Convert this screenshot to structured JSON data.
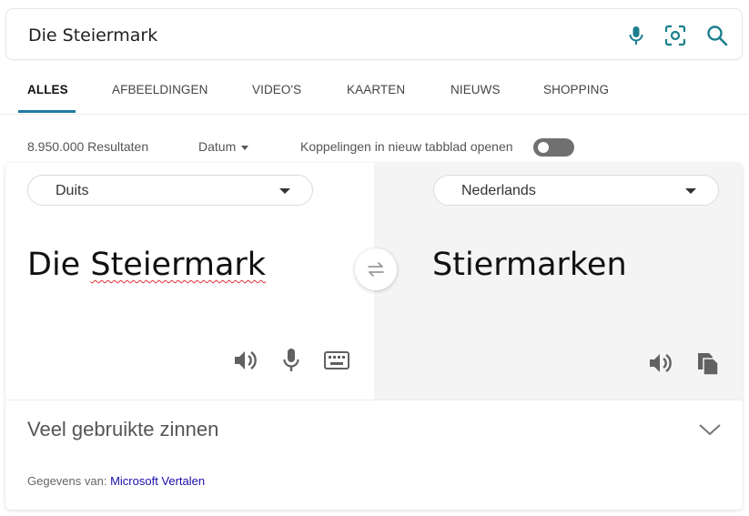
{
  "search": {
    "query": "Die Steiermark"
  },
  "icons": {
    "mic": "microphone-icon",
    "visual": "visual-search-icon",
    "search": "search-icon"
  },
  "tabs": [
    {
      "label": "ALLES",
      "active": true
    },
    {
      "label": "AFBEELDINGEN"
    },
    {
      "label": "VIDEO'S"
    },
    {
      "label": "KAARTEN"
    },
    {
      "label": "NIEUWS"
    },
    {
      "label": "SHOPPING"
    }
  ],
  "meta": {
    "results": "8.950.000 Resultaten",
    "date_filter": "Datum",
    "new_tab_label": "Koppelingen in nieuw tabblad openen",
    "new_tab_enabled": false
  },
  "translator": {
    "source_lang": "Duits",
    "target_lang": "Nederlands",
    "source_word_1": "Die",
    "source_word_2": "Steiermark",
    "target_text": "Stiermarken",
    "phrases_label": "Veel gebruikte zinnen",
    "attribution_prefix": "Gegevens van:",
    "attribution_link": "Microsoft Vertalen"
  },
  "colors": {
    "accent": "#217aa6",
    "icon_teal": "#1b7f8c",
    "link": "#1a0dab"
  }
}
